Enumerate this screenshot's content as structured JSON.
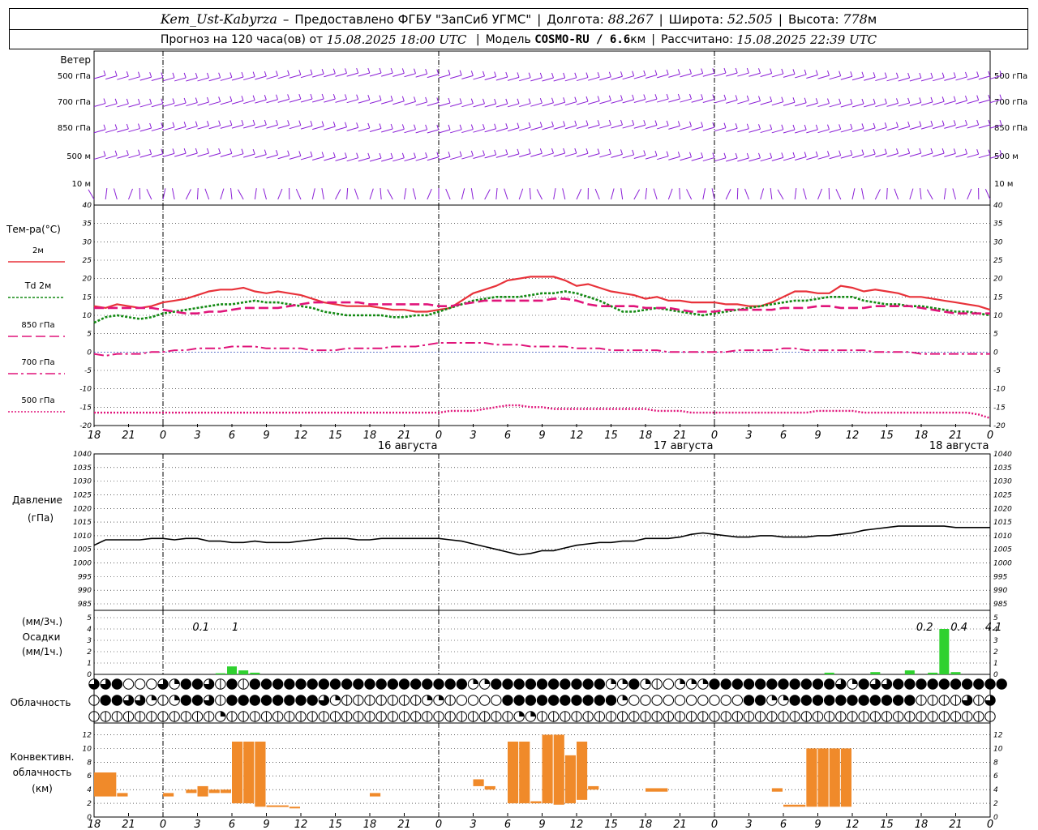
{
  "header": {
    "station": "Kem_Ust-Kabyrza",
    "dash": "–",
    "provider": "Предоставлено ФГБУ \"ЗапСиб УГМС\"",
    "lon_label": "Долгота:",
    "lon": "88.267",
    "lat_label": "Широта:",
    "lat": "52.505",
    "alt_label": "Высота:",
    "alt": "778",
    "alt_unit": "м",
    "forecast_label": "Прогноз на 120 часа(ов) от",
    "forecast_start": "15.08.2025 18:00 UTC",
    "model_label": "Модель",
    "model": "COSMO-RU / 6.6",
    "model_unit": "км",
    "calc_label": "Рассчитано:",
    "calc_time": "15.08.2025 22:39 UTC"
  },
  "x_axis": {
    "hour_ticks": [
      "18",
      "21",
      "0",
      "3",
      "6",
      "9",
      "12",
      "15",
      "18",
      "21",
      "0",
      "3",
      "6",
      "9",
      "12",
      "15",
      "18",
      "21",
      "0",
      "3",
      "6",
      "9",
      "12",
      "15",
      "18",
      "21",
      "0"
    ],
    "dates": [
      "16 августа",
      "17 августа",
      "18 августа"
    ]
  },
  "wind": {
    "title": "Ветер",
    "levels": [
      "500 гПа",
      "700 гПа",
      "850 гПа",
      "500 м",
      "10 м"
    ]
  },
  "colors": {
    "wind": "#8a1ed6",
    "t2m": "#e8323a",
    "td2m": "#138a13",
    "t850": "#e0147a",
    "precip": "#2fd12f",
    "conv": "#f08a2a"
  },
  "chart_data": [
    {
      "type": "line",
      "title": "Тем-ра(°C)",
      "ylim": [
        -20,
        40
      ],
      "yticks": [
        "40",
        "35",
        "30",
        "25",
        "20",
        "15",
        "10",
        "5",
        "0",
        "-5",
        "-10",
        "-15",
        "-20"
      ],
      "x_hours": [
        0,
        3,
        6,
        9,
        12,
        15,
        18,
        21,
        24,
        27,
        30,
        33,
        36,
        39,
        42,
        45,
        48,
        51,
        54,
        57,
        60,
        63,
        66,
        69,
        72,
        75,
        78,
        81,
        84,
        87,
        90,
        93,
        96,
        99,
        102,
        105,
        108,
        111,
        114,
        117,
        120,
        123,
        126,
        129,
        132,
        135,
        138,
        141,
        144,
        147,
        150,
        153,
        156,
        159,
        162,
        165,
        168,
        171,
        174,
        177,
        180,
        183,
        186,
        189,
        192,
        195,
        198,
        201,
        204,
        207,
        210,
        213,
        216,
        219,
        222,
        225,
        228,
        231,
        234
      ],
      "series": [
        {
          "name": "2м",
          "values": [
            12.5,
            12,
            13,
            12.5,
            12,
            12.5,
            13.5,
            14,
            14.5,
            15.5,
            16.5,
            17,
            17,
            17.5,
            16.5,
            16,
            16.5,
            16,
            15.5,
            14.5,
            13.5,
            13,
            12.5,
            12.5,
            12.5,
            12,
            11.5,
            11.5,
            11,
            11,
            11.5,
            12,
            14,
            16,
            17,
            18,
            19.5,
            20,
            20.5,
            20.5,
            20.5,
            19.5,
            18,
            18.5,
            17.5,
            16.5,
            16,
            15.5,
            14.5,
            15,
            14,
            14,
            13.5,
            13.5,
            13.5,
            13,
            13,
            12.5,
            12.5,
            13.5,
            15,
            16.5,
            16.5,
            16,
            16,
            18,
            17.5,
            16.5,
            17,
            16.5,
            16,
            15,
            15,
            14.5,
            14,
            13.5,
            13,
            12.5,
            11.5
          ]
        },
        {
          "name": "Td 2м",
          "values": [
            8,
            9.5,
            10,
            9.5,
            9,
            9.5,
            10.5,
            11,
            11.5,
            12,
            12.5,
            13,
            13,
            13.5,
            14,
            13.5,
            13.5,
            13,
            12.5,
            12,
            11,
            10.5,
            10,
            10,
            10,
            10,
            9.5,
            9.5,
            10,
            10,
            11,
            12,
            13,
            14,
            14.5,
            15,
            15,
            15,
            15.5,
            16,
            16,
            16.5,
            16,
            15,
            14,
            12.5,
            11,
            11,
            11.5,
            12,
            11.5,
            11,
            10.5,
            10,
            10.5,
            11,
            11.5,
            12,
            12.5,
            13,
            13.5,
            14,
            14,
            14.5,
            15,
            15,
            15,
            14,
            13.5,
            13,
            13,
            12.5,
            12.5,
            12,
            11.5,
            11,
            11,
            10.5,
            10
          ]
        },
        {
          "name": "850 гПа",
          "values": [
            12,
            12,
            12,
            12,
            12,
            12,
            11.5,
            11,
            10.5,
            10.5,
            11,
            11,
            11.5,
            12,
            12,
            12,
            12,
            12.5,
            13,
            13.5,
            13.5,
            13.5,
            13.5,
            13.5,
            13,
            13,
            13,
            13,
            13,
            13,
            12.5,
            12.5,
            13,
            13.5,
            14,
            14,
            14,
            14,
            14,
            14,
            14.5,
            14.5,
            14,
            13,
            12.5,
            12.5,
            12.5,
            12.5,
            12,
            12,
            12,
            11.5,
            11,
            11,
            11,
            11.5,
            11.5,
            11.5,
            11.5,
            11.5,
            12,
            12,
            12,
            12.5,
            12.5,
            12,
            12,
            12,
            12.5,
            12.5,
            12.5,
            12.5,
            12,
            11.5,
            11,
            10.5,
            10.5,
            10.5,
            10.5
          ]
        },
        {
          "name": "700 гПа",
          "values": [
            -0.5,
            -1,
            -0.5,
            -0.5,
            -0.5,
            0,
            0,
            0.5,
            0.5,
            1,
            1,
            1,
            1.5,
            1.5,
            1.5,
            1,
            1,
            1,
            1,
            0.5,
            0.5,
            0.5,
            1,
            1,
            1,
            1,
            1.5,
            1.5,
            1.5,
            2,
            2.5,
            2.5,
            2.5,
            2.5,
            2.5,
            2,
            2,
            2,
            1.5,
            1.5,
            1.5,
            1.5,
            1,
            1,
            1,
            0.5,
            0.5,
            0.5,
            0.5,
            0.5,
            0,
            0,
            0,
            0,
            0,
            0,
            0.5,
            0.5,
            0.5,
            0.5,
            1,
            1,
            0.5,
            0.5,
            0.5,
            0.5,
            0.5,
            0.5,
            0,
            0,
            0,
            0,
            -0.5,
            -0.5,
            -0.5,
            -0.5,
            -0.5,
            -0.5,
            -0.5
          ]
        },
        {
          "name": "500 гПа",
          "values": [
            -16.5,
            -16.5,
            -16.5,
            -16.5,
            -16.5,
            -16.5,
            -16.5,
            -16.5,
            -16.5,
            -16.5,
            -16.5,
            -16.5,
            -16.5,
            -16.5,
            -16.5,
            -16.5,
            -16.5,
            -16.5,
            -16.5,
            -16.5,
            -16.5,
            -16.5,
            -16.5,
            -16.5,
            -16.5,
            -16.5,
            -16.5,
            -16.5,
            -16.5,
            -16.5,
            -16.5,
            -16,
            -16,
            -16,
            -15.5,
            -15,
            -14.5,
            -14.5,
            -15,
            -15,
            -15.5,
            -15.5,
            -15.5,
            -15.5,
            -15.5,
            -15.5,
            -15.5,
            -15.5,
            -15.5,
            -16,
            -16,
            -16,
            -16.5,
            -16.5,
            -16.5,
            -16.5,
            -16.5,
            -16.5,
            -16.5,
            -16.5,
            -16.5,
            -16.5,
            -16.5,
            -16,
            -16,
            -16,
            -16,
            -16.5,
            -16.5,
            -16.5,
            -16.5,
            -16.5,
            -16.5,
            -16.5,
            -16.5,
            -16.5,
            -16.5,
            -17,
            -18
          ]
        }
      ]
    },
    {
      "type": "line",
      "title": "Давление",
      "ylabel": "(гПа)",
      "ylim": [
        985,
        1040
      ],
      "yticks": [
        "1040",
        "1035",
        "1030",
        "1025",
        "1020",
        "1015",
        "1010",
        "1005",
        "1000",
        "995",
        "990",
        "985"
      ],
      "series": [
        {
          "name": "Давление",
          "values": [
            1006.5,
            1008.5,
            1008.5,
            1008.5,
            1008.5,
            1009,
            1009,
            1008.5,
            1009,
            1009,
            1008,
            1008,
            1007.5,
            1007.5,
            1008,
            1007.5,
            1007.5,
            1007.5,
            1008,
            1008.5,
            1009,
            1009,
            1009,
            1008.5,
            1008.5,
            1009,
            1009,
            1009,
            1009,
            1009,
            1009,
            1008.5,
            1008,
            1007,
            1006,
            1005,
            1004,
            1003,
            1003.5,
            1004.5,
            1004.5,
            1005.5,
            1006.5,
            1007,
            1007.5,
            1007.5,
            1008,
            1008,
            1009,
            1009,
            1009,
            1009.5,
            1010.5,
            1011,
            1010.5,
            1010,
            1009.5,
            1009.5,
            1010,
            1010,
            1009.5,
            1009.5,
            1009.5,
            1010,
            1010,
            1010.5,
            1011,
            1012,
            1012.5,
            1013,
            1013.5,
            1013.5,
            1013.5,
            1013.5,
            1013.5,
            1013,
            1013,
            1013,
            1013
          ]
        }
      ]
    },
    {
      "type": "bar",
      "title": "Осадки",
      "ylabel_top": "(мм/3ч.)",
      "ylabel_bottom": "(мм/1ч.)",
      "ylim": [
        0,
        5
      ],
      "yticks": [
        "5",
        "4",
        "3",
        "2",
        "1",
        "0"
      ],
      "labels": [
        {
          "x_hour": 10,
          "text": "0.1"
        },
        {
          "x_hour": 13,
          "text": "1"
        },
        {
          "x_hour": 73,
          "text": "0.2"
        },
        {
          "x_hour": 76,
          "text": "0.4"
        },
        {
          "x_hour": 79,
          "text": "4.1"
        },
        {
          "x_hour": 169,
          "text": "0.4"
        },
        {
          "x_hour": 172,
          "text": "0.2"
        }
      ],
      "bars": [
        {
          "x_hour": 11,
          "value": 0.1
        },
        {
          "x_hour": 12,
          "value": 0.7
        },
        {
          "x_hour": 13,
          "value": 0.35
        },
        {
          "x_hour": 14,
          "value": 0.15
        },
        {
          "x_hour": 64,
          "value": 0.15
        },
        {
          "x_hour": 68,
          "value": 0.2
        },
        {
          "x_hour": 71,
          "value": 0.35
        },
        {
          "x_hour": 73,
          "value": 0.15
        },
        {
          "x_hour": 74,
          "value": 4
        },
        {
          "x_hour": 75,
          "value": 0.2
        },
        {
          "x_hour": 168,
          "value": 0.15
        },
        {
          "x_hour": 169,
          "value": 0.4
        },
        {
          "x_hour": 170,
          "value": 0.15
        },
        {
          "x_hour": 171,
          "value": 0.1
        }
      ]
    },
    {
      "type": "table",
      "title": "Облачность",
      "rows": [
        "3,3,4,0,0,0,3,2,4,4,3,1,4,1,4,4,4,4,4,4,4,4,4,4,4,4,4,4,4,4,4,4,4,2,2,4,4,4,4,4,4,4,4,4,4,2,2,4,2,1,0,2,2,2,4,4,4,4,4,4,4,4,4,4,4,3,2,4,3,3,4,4,4,4,4,4,4,4,4,4",
        "1,4,4,3,3,2,1,2,4,4,3,1,4,4,4,4,4,4,4,4,3,2,1,1,1,1,1,1,1,2,2,1,0,0,0,0,4,4,4,4,4,4,4,4,4,4,2,0,0,0,0,0,0,0,0,0,0,4,4,2,2,4,4,4,4,4,4,4,4,4,4,4,1,1,1,1,3,1,3",
        "1,1,1,1,1,1,1,1,1,1,1,2,1,1,1,1,1,1,1,1,1,1,1,1,1,1,1,1,1,1,1,1,1,1,1,1,1,2,2,1,1,1,1,1,1,1,1,1,1,1,1,1,1,1,1,1,1,1,1,1,1,1,1,1,1,1,1,1,1,1,1,1,1,1,1,1,1,1,1"
      ]
    },
    {
      "type": "bar",
      "title": "Конвективн. облачность",
      "ylabel": "(км)",
      "ylim": [
        0,
        13
      ],
      "yticks": [
        "12",
        "10",
        "8",
        "6",
        "4",
        "2",
        "0"
      ],
      "ranges": [
        {
          "from": 0,
          "to": 2,
          "bottom": 3,
          "top": 6.5
        },
        {
          "from": 2,
          "to": 3,
          "bottom": 3,
          "top": 3.5
        },
        {
          "from": 6,
          "to": 7,
          "bottom": 3,
          "top": 3.5
        },
        {
          "from": 8,
          "to": 9,
          "bottom": 3.5,
          "top": 4
        },
        {
          "from": 9,
          "to": 10,
          "bottom": 3,
          "top": 4.5
        },
        {
          "from": 10,
          "to": 11,
          "bottom": 3.5,
          "top": 4
        },
        {
          "from": 11,
          "to": 12,
          "bottom": 3.5,
          "top": 4
        },
        {
          "from": 12,
          "to": 13,
          "bottom": 2,
          "top": 11
        },
        {
          "from": 13,
          "to": 14,
          "bottom": 2,
          "top": 11
        },
        {
          "from": 14,
          "to": 15,
          "bottom": 1.5,
          "top": 11
        },
        {
          "from": 15,
          "to": 17,
          "bottom": 1.5,
          "top": 1.7
        },
        {
          "from": 17,
          "to": 18,
          "bottom": 1.3,
          "top": 1.5
        },
        {
          "from": 24,
          "to": 25,
          "bottom": 3,
          "top": 3.5
        },
        {
          "from": 33,
          "to": 34,
          "bottom": 4.5,
          "top": 5.5
        },
        {
          "from": 34,
          "to": 35,
          "bottom": 4,
          "top": 4.5
        },
        {
          "from": 36,
          "to": 37,
          "bottom": 2,
          "top": 11
        },
        {
          "from": 37,
          "to": 38,
          "bottom": 2,
          "top": 11
        },
        {
          "from": 38,
          "to": 39,
          "bottom": 2,
          "top": 2.3
        },
        {
          "from": 39,
          "to": 40,
          "bottom": 2,
          "top": 12
        },
        {
          "from": 40,
          "to": 41,
          "bottom": 1.8,
          "top": 12
        },
        {
          "from": 41,
          "to": 42,
          "bottom": 2,
          "top": 9
        },
        {
          "from": 42,
          "to": 43,
          "bottom": 2.5,
          "top": 11
        },
        {
          "from": 43,
          "to": 44,
          "bottom": 4,
          "top": 4.5
        },
        {
          "from": 48,
          "to": 50,
          "bottom": 3.7,
          "top": 4.2
        },
        {
          "from": 59,
          "to": 60,
          "bottom": 3.7,
          "top": 4.2
        },
        {
          "from": 60,
          "to": 62,
          "bottom": 1.5,
          "top": 1.8
        },
        {
          "from": 62,
          "to": 63,
          "bottom": 1.5,
          "top": 10
        },
        {
          "from": 63,
          "to": 64,
          "bottom": 1.5,
          "top": 10
        },
        {
          "from": 64,
          "to": 65,
          "bottom": 1.5,
          "top": 10
        },
        {
          "from": 65,
          "to": 66,
          "bottom": 1.5,
          "top": 10
        }
      ]
    }
  ]
}
